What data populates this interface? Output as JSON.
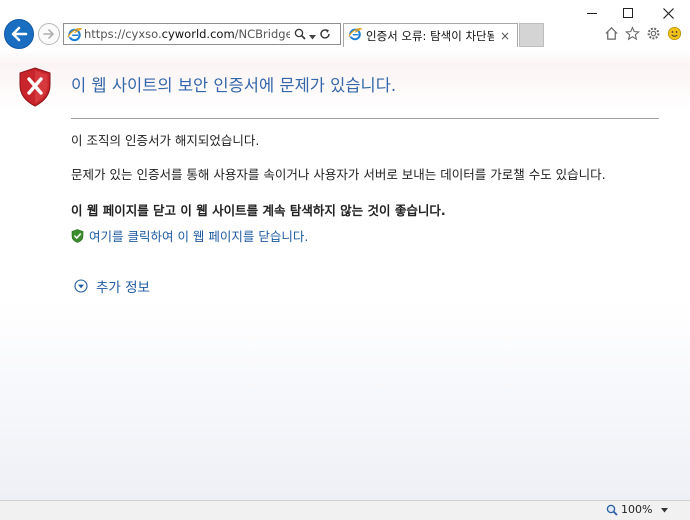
{
  "window": {
    "minimize_label": "minimize",
    "maximize_label": "maximize",
    "close_label": "close"
  },
  "addressbar": {
    "url_prefix": "https://cyxso.",
    "url_host": "cyworld.com",
    "url_rest": "/NCBridge.sk?info"
  },
  "tab": {
    "title": "인증서 오류: 탐색이 차단됨",
    "close_glyph": "×"
  },
  "page": {
    "title": "이 웹 사이트의 보안 인증서에 문제가 있습니다.",
    "revoked": "이 조직의 인증서가 해지되었습니다.",
    "risk": "문제가 있는 인증서를 통해 사용자를 속이거나 사용자가 서버로 보내는 데이터를 가로챌 수도 있습니다.",
    "advice": "이 웹 페이지를 닫고 이 웹 사이트를 계속 탐색하지 않는 것이 좋습니다.",
    "close_link": "여기를 클릭하여 이 웹 페이지를 닫습니다.",
    "more_info": "추가 정보"
  },
  "statusbar": {
    "zoom": "100%"
  },
  "colors": {
    "title_blue": "#3366aa",
    "link_blue": "#1e5aa0",
    "shield_red": "#c8242b",
    "back_blue": "#1a6ec2"
  },
  "icons": {
    "back": "back-arrow-icon",
    "forward": "forward-arrow-icon",
    "ie": "ie-logo-icon",
    "search": "search-icon",
    "refresh": "refresh-icon",
    "home": "home-icon",
    "favorites": "star-icon",
    "settings": "gear-icon",
    "feedback": "smiley-icon",
    "shield_error": "shield-error-icon",
    "shield_ok": "shield-check-icon",
    "expand": "chevron-down-circle-icon",
    "zoom": "magnifier-icon"
  }
}
